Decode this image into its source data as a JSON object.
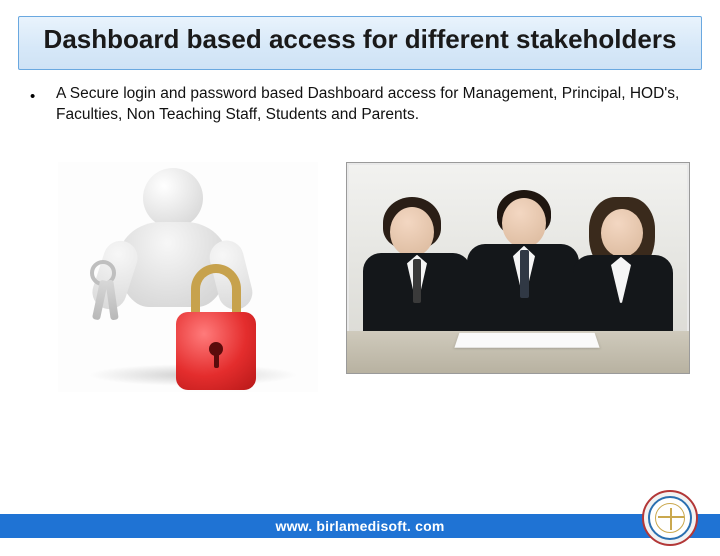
{
  "title": "Dashboard based access for different stakeholders",
  "bullet": {
    "marker": "•",
    "text": "A Secure login and password based Dashboard access for Management, Principal, HOD's, Faculties, Non Teaching Staff, Students and Parents."
  },
  "footer": {
    "url": "www. birlamedisoft. com"
  }
}
